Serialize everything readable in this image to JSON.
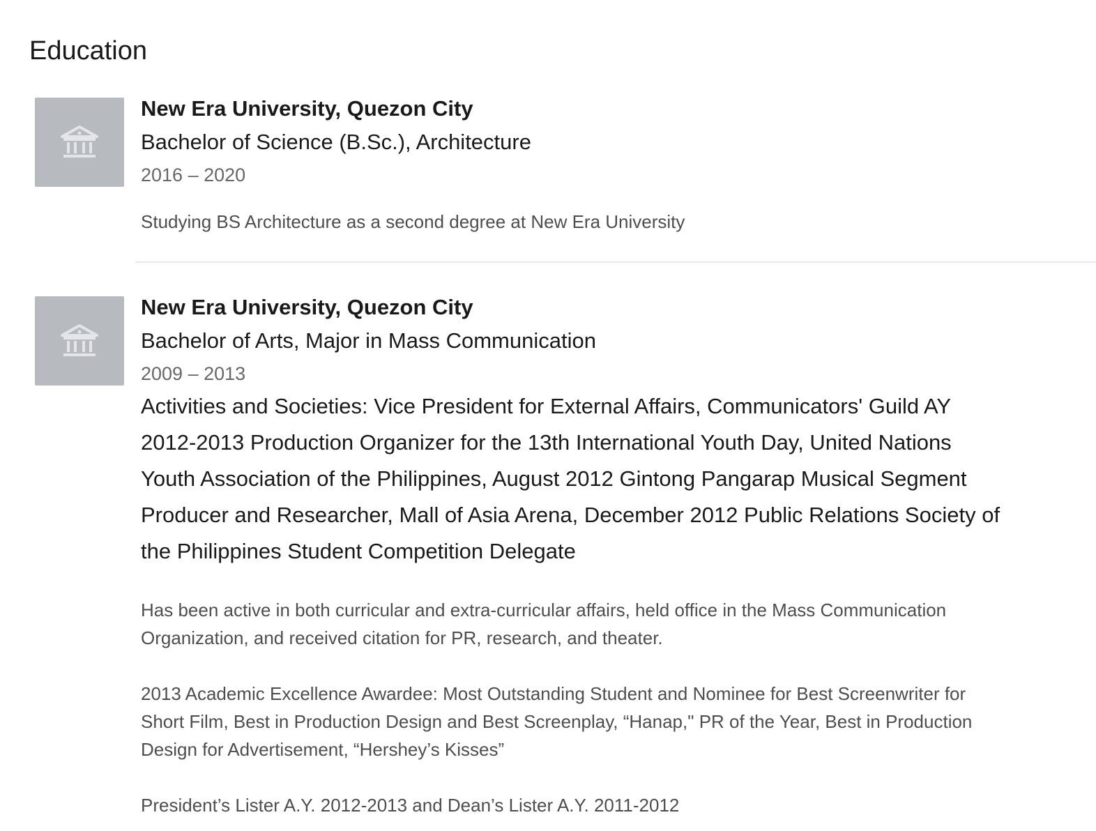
{
  "section": {
    "title": "Education"
  },
  "entries": [
    {
      "logo_icon": "institution-icon",
      "school": "New Era University, Quezon City",
      "degree": "Bachelor of Science (B.Sc.), Architecture",
      "dates": "2016 – 2020",
      "description": [
        "Studying BS Architecture as a second degree at New Era University"
      ]
    },
    {
      "logo_icon": "institution-icon",
      "school": "New Era University, Quezon City",
      "degree": "Bachelor of Arts, Major in Mass Communication",
      "dates": "2009 – 2013",
      "activities": "Activities and Societies: Vice President for External Affairs, Communicators' Guild AY 2012-2013 Production Organizer for the 13th International Youth Day, United Nations Youth Association of the Philippines, August 2012 Gintong Pangarap Musical Segment Producer and Researcher, Mall of Asia Arena, December 2012 Public Relations Society of the Philippines Student Competition Delegate",
      "description": [
        "Has been active in both curricular and extra-curricular affairs, held office in the Mass Communication Organization, and received citation for PR, research, and theater.",
        "2013 Academic Excellence Awardee: Most Outstanding Student and Nominee for Best Screenwriter for Short Film, Best in Production Design and Best Screenplay, “Hanap,\" PR of the Year, Best in Production Design for Advertisement, “Hershey’s Kisses”",
        "President’s Lister A.Y. 2012-2013 and Dean’s Lister A.Y. 2011-2012"
      ]
    }
  ],
  "colors": {
    "logo_placeholder": "#b7bbc0",
    "divider": "#e6e9ec"
  }
}
